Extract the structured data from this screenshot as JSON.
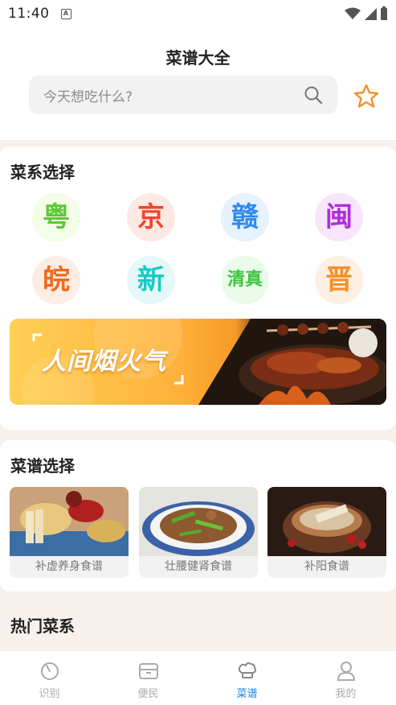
{
  "status": {
    "time": "11:40",
    "indicator": "A"
  },
  "header": {
    "title": "菜谱大全",
    "search_placeholder": "今天想吃什么?",
    "search_icon": "search-icon",
    "favorite_icon": "star-icon"
  },
  "cuisine": {
    "title": "菜系选择",
    "items": [
      {
        "label": "粤",
        "color": "#5fc73a",
        "bg": "#f4fde6"
      },
      {
        "label": "京",
        "color": "#f2452c",
        "bg": "#fde9e4"
      },
      {
        "label": "赣",
        "color": "#2f89f0",
        "bg": "#e6f2fd"
      },
      {
        "label": "闽",
        "color": "#b02ee0",
        "bg": "#f7e5fb"
      },
      {
        "label": "皖",
        "color": "#f26a1b",
        "bg": "#fdede3"
      },
      {
        "label": "新",
        "color": "#1ac8c8",
        "bg": "#e4f8f8"
      },
      {
        "label": "清真",
        "color": "#3cc43c",
        "bg": "#eafbea"
      },
      {
        "label": "晋",
        "color": "#f5902a",
        "bg": "#fdf0e3"
      }
    ],
    "banner_text": "人间烟火气"
  },
  "recipes": {
    "title": "菜谱选择",
    "items": [
      {
        "label": "补虚养身食谱"
      },
      {
        "label": "壮腰健肾食谱"
      },
      {
        "label": "补阳食谱"
      }
    ]
  },
  "hot": {
    "title": "热门菜系"
  },
  "tabs": [
    {
      "label": "识别",
      "icon": "scan-icon"
    },
    {
      "label": "便民",
      "icon": "box-icon"
    },
    {
      "label": "菜谱",
      "icon": "chef-hat-icon"
    },
    {
      "label": "我的",
      "icon": "user-icon"
    }
  ],
  "colors": {
    "accent": "#1b87e6",
    "star": "#f5902a"
  }
}
